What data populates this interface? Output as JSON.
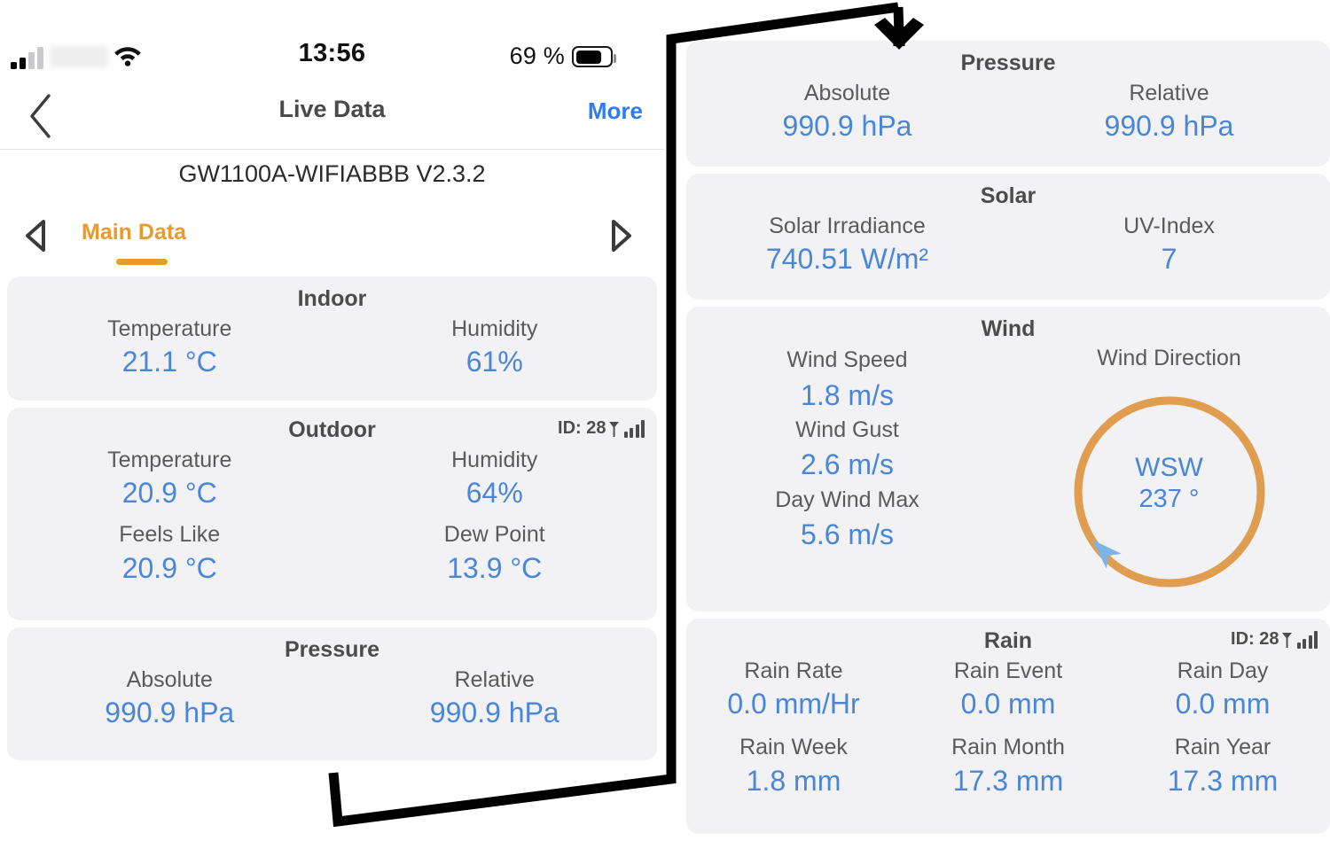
{
  "status_bar": {
    "carrier": "",
    "time": "13:56",
    "battery_percent": "69 %",
    "signal_icon": "cellular-signal-icon",
    "wifi_icon": "wifi-icon",
    "battery_icon": "battery-icon"
  },
  "nav": {
    "back_icon": "chevron-left-icon",
    "title": "Live Data",
    "more_label": "More"
  },
  "device": {
    "title": "GW1100A-WIFIABBB V2.3.2"
  },
  "tabs": {
    "prev_icon": "triangle-left-icon",
    "next_icon": "triangle-right-icon",
    "active_label": "Main Data"
  },
  "colors": {
    "value_blue": "#4a86d8",
    "accent_orange": "#e99a2e",
    "link_blue": "#2f7bf0",
    "card_bg": "#f2f2f4",
    "label_gray": "#5a5a5a",
    "title_gray": "#4c4c4c",
    "compass_ring": "#e09c4f",
    "compass_needle": "#7cb3e8"
  },
  "cards": {
    "indoor": {
      "title": "Indoor",
      "items": [
        {
          "label": "Temperature",
          "value": "21.1 °C"
        },
        {
          "label": "Humidity",
          "value": "61%"
        }
      ]
    },
    "outdoor": {
      "title": "Outdoor",
      "badge": {
        "text": "ID: 28",
        "antenna_icon": "antenna-icon",
        "signal_icon": "signal-bars-icon"
      },
      "items": [
        {
          "label": "Temperature",
          "value": "20.9 °C"
        },
        {
          "label": "Humidity",
          "value": "64%"
        },
        {
          "label": "Feels Like",
          "value": "20.9 °C"
        },
        {
          "label": "Dew Point",
          "value": "13.9 °C"
        }
      ]
    },
    "pressure_left": {
      "title": "Pressure",
      "items": [
        {
          "label": "Absolute",
          "value": "990.9 hPa"
        },
        {
          "label": "Relative",
          "value": "990.9 hPa"
        }
      ]
    },
    "pressure_right": {
      "title": "Pressure",
      "items": [
        {
          "label": "Absolute",
          "value": "990.9 hPa"
        },
        {
          "label": "Relative",
          "value": "990.9 hPa"
        }
      ]
    },
    "solar": {
      "title": "Solar",
      "items": [
        {
          "label": "Solar Irradiance",
          "value": "740.51 W/m²"
        },
        {
          "label": "UV-Index",
          "value": "7"
        }
      ]
    },
    "wind": {
      "title": "Wind",
      "left_items": [
        {
          "label": "Wind Speed",
          "value": "1.8 m/s"
        },
        {
          "label": "Wind Gust",
          "value": "2.6 m/s"
        },
        {
          "label": "Day Wind Max",
          "value": "5.6 m/s"
        }
      ],
      "direction_label": "Wind Direction",
      "compass": {
        "cardinal": "WSW",
        "degrees": "237 °",
        "degrees_numeric": 237
      }
    },
    "rain": {
      "title": "Rain",
      "badge": {
        "text": "ID: 28",
        "antenna_icon": "antenna-icon",
        "signal_icon": "signal-bars-icon"
      },
      "items": [
        {
          "label": "Rain Rate",
          "value": "0.0 mm/Hr"
        },
        {
          "label": "Rain Event",
          "value": "0.0 mm"
        },
        {
          "label": "Rain Day",
          "value": "0.0 mm"
        },
        {
          "label": "Rain Week",
          "value": "1.8 mm"
        },
        {
          "label": "Rain Month",
          "value": "17.3 mm"
        },
        {
          "label": "Rain Year",
          "value": "17.3 mm"
        }
      ]
    }
  },
  "annotation": {
    "type": "callout-arrow",
    "color": "#000000"
  }
}
